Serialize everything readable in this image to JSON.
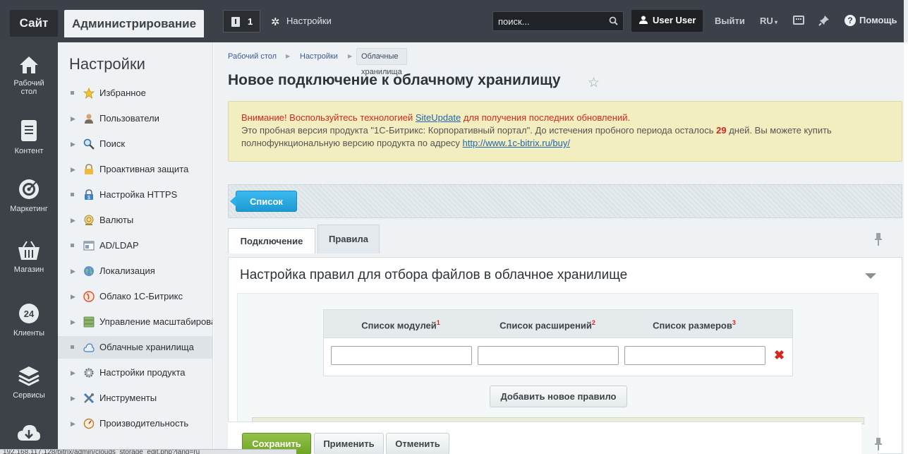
{
  "header": {
    "tab_site": "Сайт",
    "tab_admin": "Администрирование",
    "notifications_count": "1",
    "settings_label": "Настройки",
    "search_placeholder": "поиск...",
    "user_label": "User User",
    "logout_label": "Выйти",
    "lang_label": "RU",
    "help_label": "Помощь"
  },
  "leftnav": [
    {
      "icon": "home-icon",
      "label1": "Рабочий",
      "label2": "стол"
    },
    {
      "icon": "document-icon",
      "label1": "Контент",
      "label2": ""
    },
    {
      "icon": "target-icon",
      "label1": "Маркетинг",
      "label2": ""
    },
    {
      "icon": "basket-icon",
      "label1": "Магазин",
      "label2": ""
    },
    {
      "icon": "clients-24-icon",
      "label1": "Клиенты",
      "label2": "",
      "badge": "24"
    },
    {
      "icon": "layers-icon",
      "label1": "Сервисы",
      "label2": ""
    }
  ],
  "sidebar": {
    "title": "Настройки",
    "items": [
      {
        "label": "Избранное",
        "icon": "star-icon",
        "marker": "square"
      },
      {
        "label": "Пользователи",
        "icon": "user-icon",
        "marker": "arrow"
      },
      {
        "label": "Поиск",
        "icon": "magnifier-icon",
        "marker": "arrow"
      },
      {
        "label": "Проактивная защита",
        "icon": "lock-icon",
        "marker": "arrow"
      },
      {
        "label": "Настройка HTTPS",
        "icon": "https-lock-icon",
        "marker": "square"
      },
      {
        "label": "Валюты",
        "icon": "coin-icon",
        "marker": "arrow"
      },
      {
        "label": "AD/LDAP",
        "icon": "ldap-icon",
        "marker": "square"
      },
      {
        "label": "Локализация",
        "icon": "globe-icon",
        "marker": "arrow"
      },
      {
        "label": "Облако 1С-Битрикс",
        "icon": "bitrix-cloud-icon",
        "marker": "arrow"
      },
      {
        "label": "Управление масштабирова",
        "icon": "servers-icon",
        "marker": "arrow"
      },
      {
        "label": "Облачные хранилища",
        "icon": "cloud-icon",
        "marker": "square",
        "active": true
      },
      {
        "label": "Настройки продукта",
        "icon": "gear-icon",
        "marker": "arrow"
      },
      {
        "label": "Инструменты",
        "icon": "tools-icon",
        "marker": "arrow"
      },
      {
        "label": "Производительность",
        "icon": "speedometer-icon",
        "marker": "arrow"
      }
    ]
  },
  "breadcrumb": {
    "item1": "Рабочий стол",
    "item2": "Настройки",
    "current": "Облачные хранилища"
  },
  "page_title": "Новое подключение к облачному хранилищу",
  "warning": {
    "line1_prefix": "Внимание! Воспользуйтесь технологией ",
    "line1_link": "SiteUpdate",
    "line1_suffix": " для получения последних обновлений.",
    "line2_prefix": "Это пробная версия продукта \"1С-Битрикс: Корпоративный портал\". До истечения пробного периода осталось ",
    "days": "29",
    "line2_suffix": " дней. Вы можете купить",
    "line3_prefix": "полнофункциональную версию продукта по адресу ",
    "line3_link": "http://www.1c-bitrix.ru/buy/"
  },
  "list_button": "Список",
  "tabs": [
    {
      "label": "Подключение",
      "active": false
    },
    {
      "label": "Правила",
      "active": true
    }
  ],
  "panel": {
    "title": "Настройка правил для отбора файлов в облачное хранилище",
    "columns": [
      {
        "label": "Список модулей",
        "sup": "1"
      },
      {
        "label": "Список расширений",
        "sup": "2"
      },
      {
        "label": "Список размеров",
        "sup": "3"
      }
    ],
    "inputs": [
      "",
      "",
      ""
    ],
    "add_rule_button": "Добавить новое правило"
  },
  "footer": {
    "save": "Сохранить",
    "apply": "Применить",
    "cancel": "Отменить"
  },
  "statusbar": "192.168.117.128/bitrix/admin/clouds_storage_edit.php?lang=ru"
}
